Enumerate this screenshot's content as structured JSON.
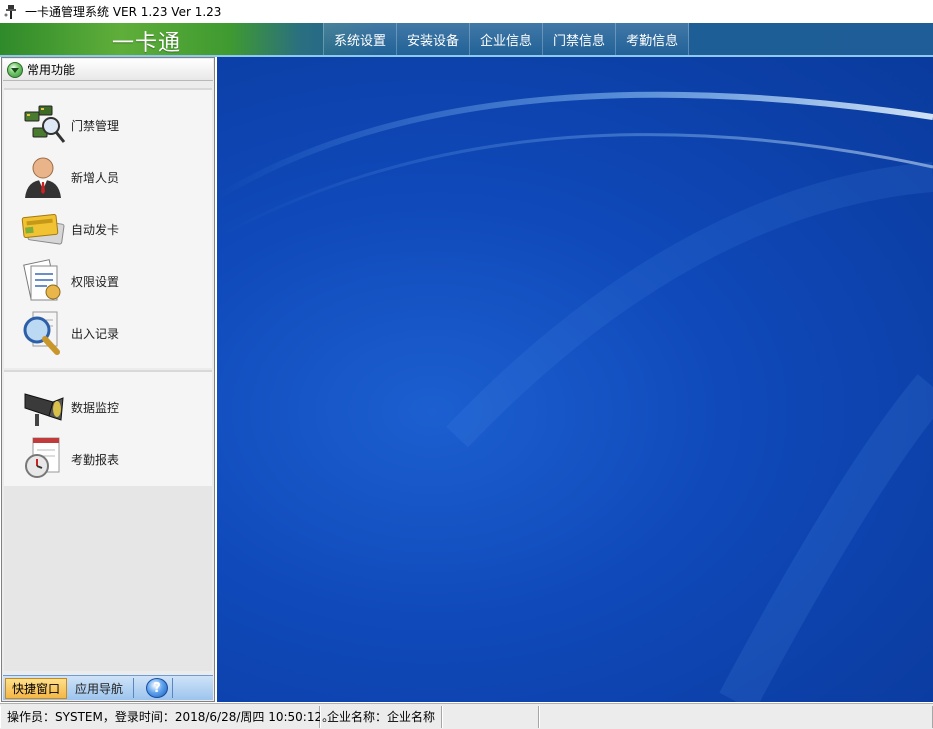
{
  "window": {
    "title": "一卡通管理系统 VER 1.23  Ver 1.23"
  },
  "banner": {
    "brand": "一卡通",
    "nav": [
      {
        "label": "系统设置"
      },
      {
        "label": "安装设备"
      },
      {
        "label": "企业信息"
      },
      {
        "label": "门禁信息"
      },
      {
        "label": "考勤信息"
      }
    ]
  },
  "sidebar": {
    "header": "常用功能",
    "group1": [
      {
        "label": "门禁管理",
        "icon": "access-control-icon"
      },
      {
        "label": "新增人员",
        "icon": "person-icon"
      },
      {
        "label": "自动发卡",
        "icon": "card-icon"
      },
      {
        "label": "权限设置",
        "icon": "permission-icon"
      },
      {
        "label": "出入记录",
        "icon": "magnifier-icon"
      }
    ],
    "group2": [
      {
        "label": "数据监控",
        "icon": "camera-icon"
      },
      {
        "label": "考勤报表",
        "icon": "stopwatch-icon"
      }
    ],
    "tabs": [
      {
        "label": "快捷窗口",
        "active": true
      },
      {
        "label": "应用导航",
        "active": false
      }
    ],
    "help": "?"
  },
  "statusbar": {
    "operator": "操作员：SYSTEM，登录时间：2018/6/28/周四 10:50:12。",
    "company": "企业名称：企业名称",
    "extra1": "",
    "extra2": ""
  },
  "colors": {
    "banner_green": "#3f9a30",
    "banner_blue": "#1e5d97",
    "desktop_blue": "#0f48b8",
    "tab_active": "#f4b646"
  }
}
